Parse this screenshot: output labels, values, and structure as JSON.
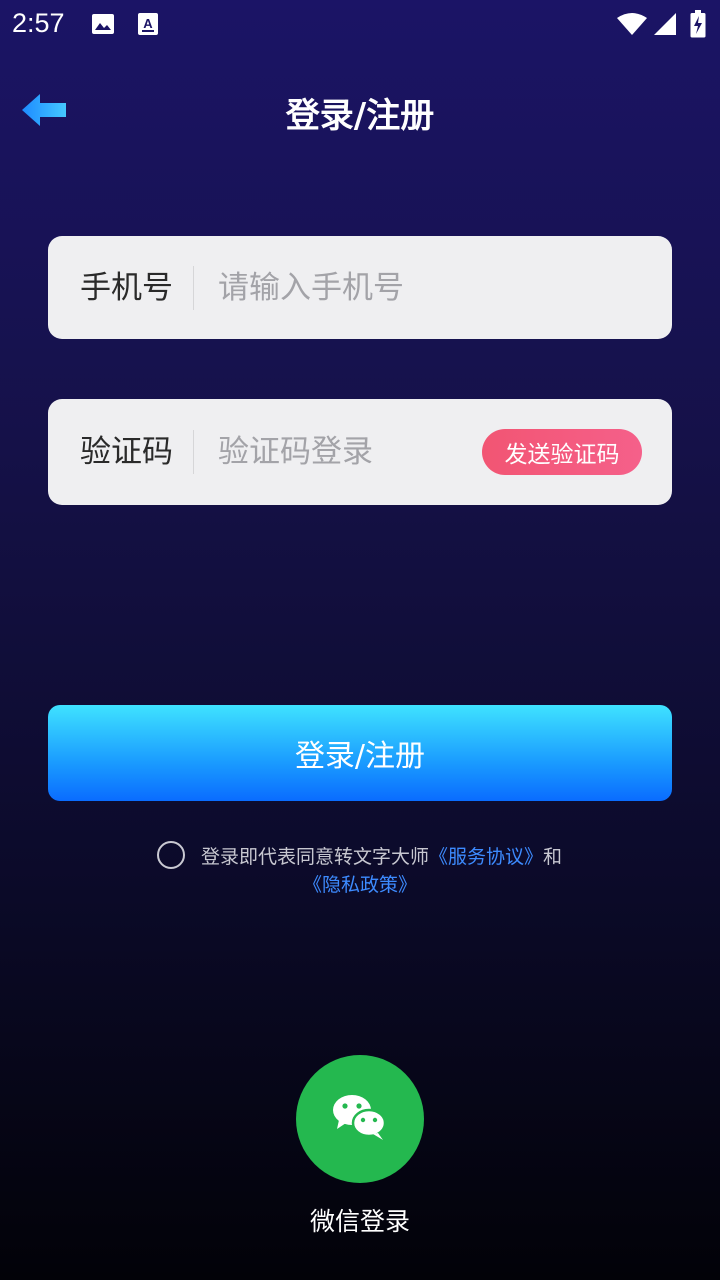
{
  "status_bar": {
    "time": "2:57",
    "icons": [
      "image-icon",
      "text-a-icon",
      "wifi-icon",
      "signal-icon",
      "battery-charging-icon"
    ]
  },
  "header": {
    "title": "登录/注册",
    "back_icon": "arrow-left-icon"
  },
  "phone_field": {
    "label": "手机号",
    "placeholder": "请输入手机号",
    "value": ""
  },
  "code_field": {
    "label": "验证码",
    "placeholder": "验证码登录",
    "value": "",
    "send_button": "发送验证码"
  },
  "login_button": "登录/注册",
  "agreement": {
    "checked": false,
    "prefix": "登录即代表同意转文字大师",
    "service_link": "《服务协议》",
    "conjunction": "和",
    "privacy_link": "《隐私政策》"
  },
  "wechat": {
    "icon": "wechat-icon",
    "label": "微信登录"
  },
  "colors": {
    "accent_blue": "#1a9bff",
    "send_code_pink": "#f25573",
    "wechat_green": "#24b84f",
    "link_blue": "#3d8bff"
  }
}
